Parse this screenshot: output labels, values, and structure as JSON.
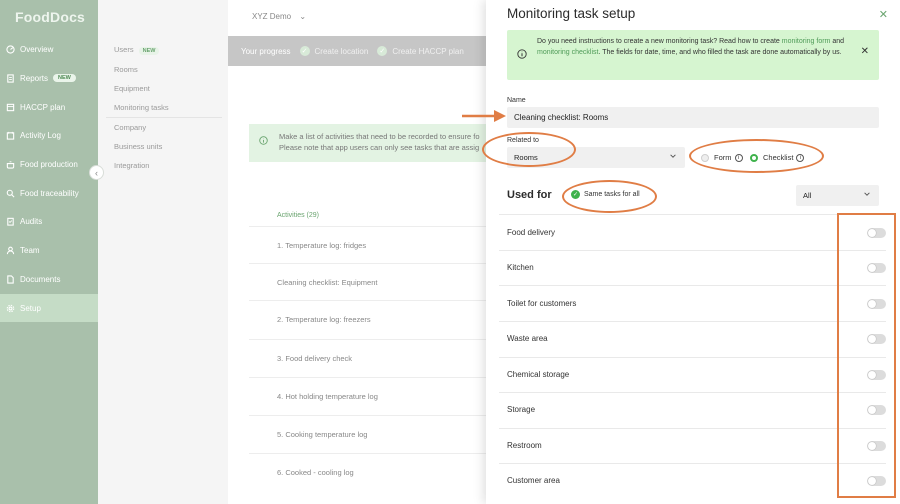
{
  "brand": {
    "logo": "FoodDocs",
    "accent": "#3fb24c",
    "annotation_color": "#e07d45"
  },
  "nav": {
    "items": [
      {
        "label": "Overview",
        "icon": "dashboard-icon"
      },
      {
        "label": "Reports",
        "icon": "report-icon",
        "badge": "NEW"
      },
      {
        "label": "HACCP plan",
        "icon": "plan-icon"
      },
      {
        "label": "Activity Log",
        "icon": "calendar-icon"
      },
      {
        "label": "Food production",
        "icon": "pot-icon"
      },
      {
        "label": "Food traceability",
        "icon": "search-icon"
      },
      {
        "label": "Audits",
        "icon": "clipboard-icon"
      },
      {
        "label": "Team",
        "icon": "person-icon"
      },
      {
        "label": "Documents",
        "icon": "document-icon"
      },
      {
        "label": "Setup",
        "icon": "gear-icon",
        "active": true
      }
    ]
  },
  "subnav": {
    "items": [
      {
        "label": "Users",
        "badge": "NEW"
      },
      {
        "label": "Rooms"
      },
      {
        "label": "Equipment"
      },
      {
        "label": "Monitoring tasks"
      },
      {
        "label": "Company"
      },
      {
        "label": "Business units"
      },
      {
        "label": "Integration"
      }
    ]
  },
  "main": {
    "company": "XYZ Demo",
    "progress": {
      "label": "Your progress",
      "steps": [
        "Create location",
        "Create HACCP plan"
      ]
    },
    "info": {
      "line1": "Make a list of activities that need to be recorded to ensure fo",
      "line2": "Please note that app users can only see tasks that are assig"
    },
    "activities_header": "Activities (29)",
    "activities": [
      "1. Temperature log: fridges",
      "Cleaning checklist: Equipment",
      "2. Temperature log: freezers",
      "3. Food delivery check",
      "4. Hot holding temperature log",
      "5. Cooking temperature log",
      "6. Cooked - cooling log"
    ]
  },
  "panel": {
    "title": "Monitoring task setup",
    "info": {
      "part1": "Do you need instructions to create a new monitoring task? Read how to create ",
      "link1": "monitoring form",
      "part2": "and ",
      "link2": "monitoring checklist",
      "part3": ". The fields for date, time, and who filled the task are done",
      "part4": "automatically by us."
    },
    "name_label": "Name",
    "name_value": "Cleaning checklist: Rooms",
    "related_label": "Related to",
    "related_value": "Rooms",
    "type_options": [
      {
        "label": "Form",
        "selected": false
      },
      {
        "label": "Checklist",
        "selected": true
      }
    ],
    "used_for_label": "Used for",
    "same_tasks_label": "Same tasks for all",
    "same_tasks_checked": true,
    "filter_value": "All",
    "rooms": [
      {
        "label": "Food delivery",
        "enabled": false
      },
      {
        "label": "Kitchen",
        "enabled": false
      },
      {
        "label": "Toilet for customers",
        "enabled": false
      },
      {
        "label": "Waste area",
        "enabled": false
      },
      {
        "label": "Chemical storage",
        "enabled": false
      },
      {
        "label": "Storage",
        "enabled": false
      },
      {
        "label": "Restroom",
        "enabled": false
      },
      {
        "label": "Customer area",
        "enabled": false
      }
    ]
  }
}
